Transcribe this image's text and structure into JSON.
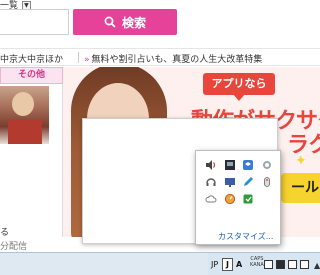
{
  "search": {
    "list_label": "一覧",
    "list_dropdown": "▼",
    "input_value": "",
    "button_label": "検索",
    "button_color": "#e6429a"
  },
  "info_bar": {
    "left_text": "中京大中京ほか",
    "right_chevron": "»",
    "right_text": "無料や割引占いも、真夏の人生大改革特集"
  },
  "left_column": {
    "tab_label": "その他",
    "news_title": "る",
    "news_sub": "分配信"
  },
  "banner": {
    "badge": "アプリなら",
    "line1": "動作がサクサク",
    "line2": "ラク",
    "button": "ール",
    "accent": "#e8463c"
  },
  "tray": {
    "customize_label": "カスタマイズ...",
    "icons": [
      "speaker-icon",
      "monitor-icon",
      "dropbox-icon",
      "network-icon",
      "headset-icon",
      "display-icon",
      "pen-icon",
      "mouse-icon",
      "cloud-icon",
      "dashboard-icon",
      "green-app-icon"
    ]
  },
  "taskbar": {
    "lang": "JP",
    "ime_mode": "J",
    "ime_alpha": "A",
    "caps_label": "CAPS",
    "kana_label": "KANA",
    "expand_icon": "chevron-up-icon"
  }
}
